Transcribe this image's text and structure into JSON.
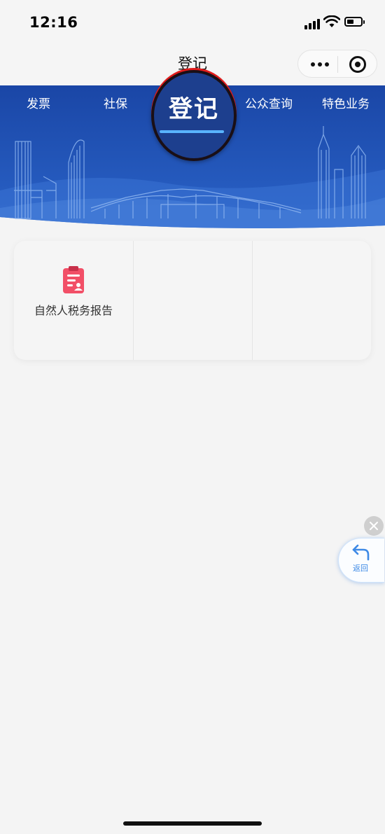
{
  "status_bar": {
    "time": "12:16"
  },
  "nav": {
    "title": "登记"
  },
  "tabs": [
    {
      "label": "发票"
    },
    {
      "label": "社保"
    },
    {
      "label": "登记"
    },
    {
      "label": "公众查询"
    },
    {
      "label": "特色业务"
    }
  ],
  "active_tab": {
    "label": "登记"
  },
  "services": [
    {
      "label": "自然人税务报告",
      "icon": "report-clipboard-icon"
    }
  ],
  "float_button": {
    "label": "返回"
  },
  "colors": {
    "banner_blue": "#1f4fb0",
    "active_underline": "#59b4ff",
    "icon_red": "#f24f67",
    "back_blue": "#3e8ae6"
  }
}
